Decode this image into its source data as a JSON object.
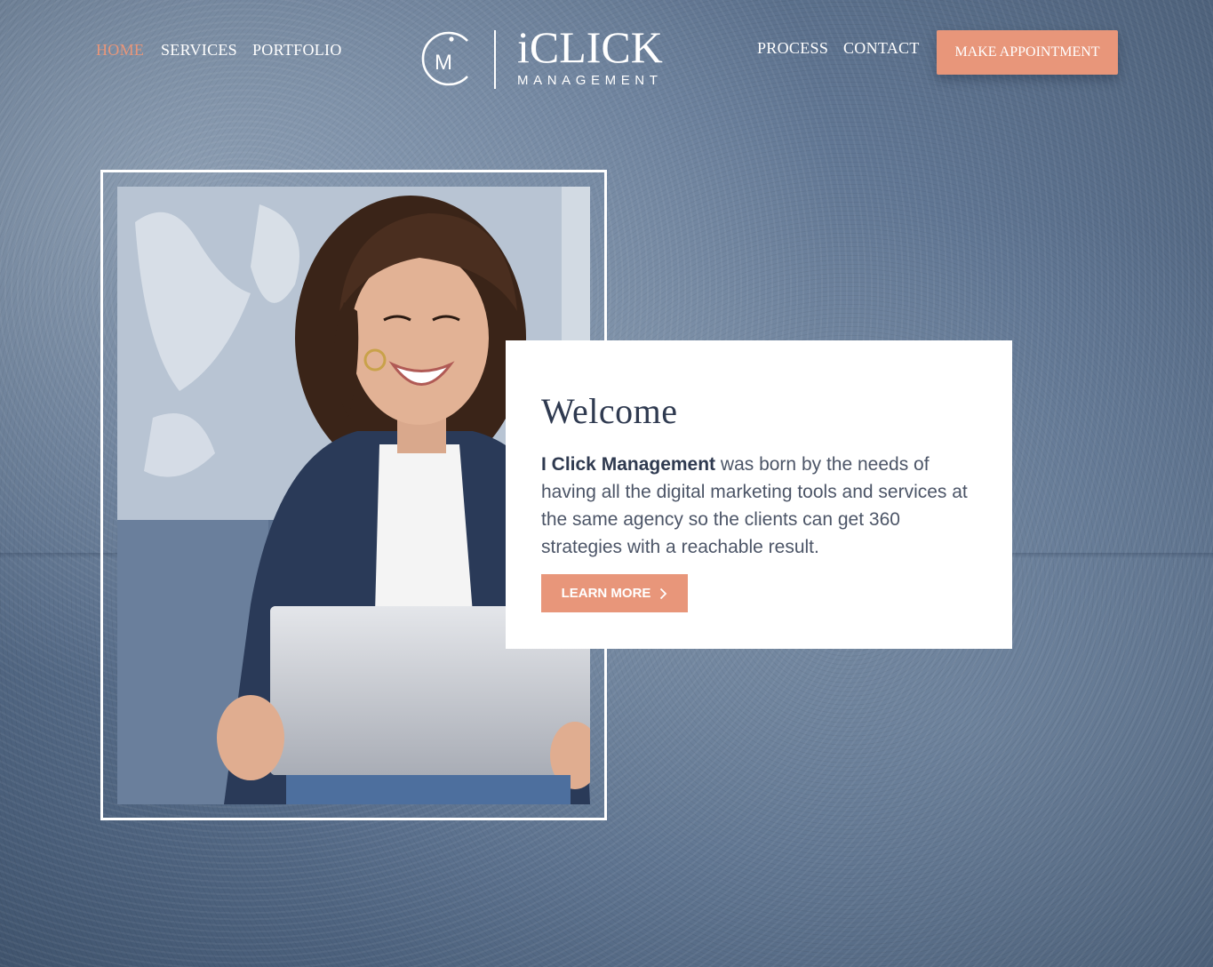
{
  "nav": {
    "left": [
      {
        "label": "HOME",
        "active": true
      },
      {
        "label": "SERVICES",
        "active": false
      },
      {
        "label": "PORTFOLIO",
        "active": false
      }
    ],
    "right": [
      {
        "label": "PROCESS"
      },
      {
        "label": "CONTACT"
      }
    ],
    "cta_label": "MAKE APPOINTMENT"
  },
  "logo": {
    "monogram": "iM",
    "word": "iCLICK",
    "sub": "MANAGEMENT"
  },
  "hero": {
    "image": "woman-laughing-with-laptop-photo"
  },
  "welcome": {
    "title": "Welcome",
    "body_bold": "I Click Management",
    "body_rest": " was born by the needs of having all the digital marketing tools and services at the same agency so the clients can get 360 strategies with a reachable result.",
    "button_label": "LEARN MORE"
  },
  "colors": {
    "accent": "#e8967a",
    "heading": "#2f3a50",
    "body_text": "#4c5567",
    "background": "#5a7190"
  }
}
